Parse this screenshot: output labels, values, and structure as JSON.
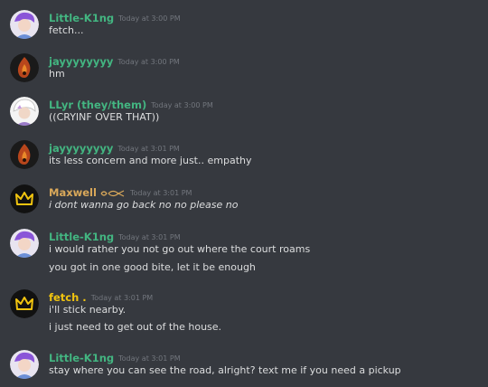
{
  "colors": {
    "background": "#36393f",
    "timestamp": "#72767d",
    "text": "#dcddde",
    "green": "#43b581",
    "tan": "#d9a85a",
    "yellow": "#f1c40f"
  },
  "messages": [
    {
      "author": "Little-K1ng",
      "author_color": "#43b581",
      "avatar": "purple-hair-avatar-icon",
      "timestamp": "Today at 3:00 PM",
      "lines": [
        "fetch..."
      ]
    },
    {
      "author": "jayyyyyyyy",
      "author_color": "#43b581",
      "avatar": "fire-avatar-icon",
      "timestamp": "Today at 3:00 PM",
      "lines": [
        "hm"
      ]
    },
    {
      "author": "LLyr (they/them)",
      "author_color": "#43b581",
      "avatar": "white-hair-avatar-icon",
      "timestamp": "Today at 3:00 PM",
      "lines": [
        "((CRYINF OVER THAT))"
      ]
    },
    {
      "author": "jayyyyyyyy",
      "author_color": "#43b581",
      "avatar": "fire-avatar-icon",
      "timestamp": "Today at 3:01 PM",
      "lines": [
        "its less concern and more just.. empathy"
      ]
    },
    {
      "author": "Maxwell",
      "author_color": "#d9a85a",
      "avatar": "crown-avatar-icon",
      "timestamp": "Today at 3:01 PM",
      "lines": [
        "i dont wanna go back no no please no"
      ],
      "name_decoration": "fish-doodle-icon"
    },
    {
      "author": "Little-K1ng",
      "author_color": "#43b581",
      "avatar": "purple-hair-avatar-icon",
      "timestamp": "Today at 3:01 PM",
      "lines": [
        "i would rather you not go out where the court roams",
        "you got in one good bite, let it be enough"
      ]
    },
    {
      "author": "fetch .",
      "author_color": "#f1c40f",
      "avatar": "crown-avatar-icon",
      "timestamp": "Today at 3:01 PM",
      "lines": [
        "i'll stick nearby.",
        "i just need to get out of the house."
      ]
    },
    {
      "author": "Little-K1ng",
      "author_color": "#43b581",
      "avatar": "purple-hair-avatar-icon",
      "timestamp": "Today at 3:01 PM",
      "lines": [
        "stay where you can see the road, alright? text me if you need a pickup"
      ]
    }
  ]
}
